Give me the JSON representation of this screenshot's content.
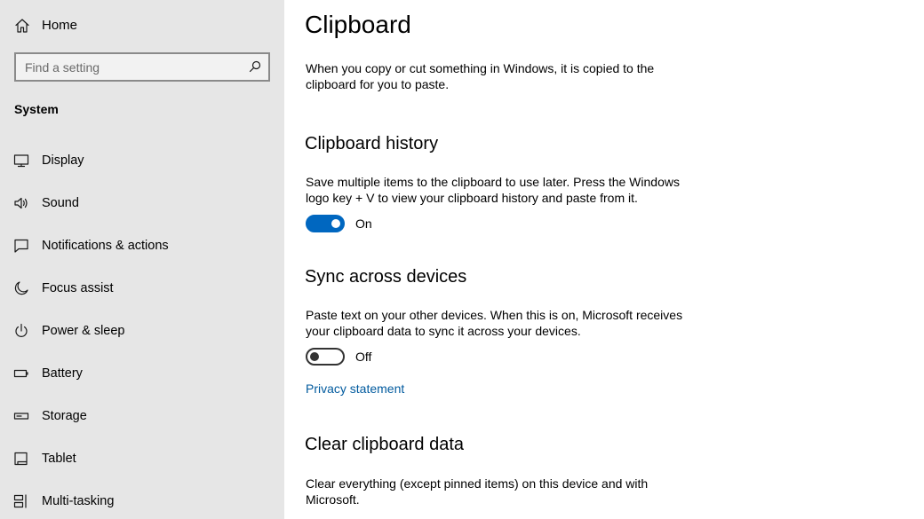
{
  "sidebar": {
    "home": {
      "label": "Home",
      "icon": "home-icon"
    },
    "search": {
      "placeholder": "Find a setting",
      "value": "",
      "icon": "search-icon"
    },
    "section_label": "System",
    "items": [
      {
        "label": "Display",
        "icon": "monitor-icon"
      },
      {
        "label": "Sound",
        "icon": "speaker-icon"
      },
      {
        "label": "Notifications & actions",
        "icon": "notification-icon"
      },
      {
        "label": "Focus assist",
        "icon": "moon-icon"
      },
      {
        "label": "Power & sleep",
        "icon": "power-icon"
      },
      {
        "label": "Battery",
        "icon": "battery-icon"
      },
      {
        "label": "Storage",
        "icon": "storage-icon"
      },
      {
        "label": "Tablet",
        "icon": "tablet-icon"
      },
      {
        "label": "Multi-tasking",
        "icon": "multitasking-icon"
      }
    ]
  },
  "main": {
    "title": "Clipboard",
    "intro": "When you copy or cut something in Windows, it is copied to the clipboard for you to paste.",
    "clipboard_history": {
      "heading": "Clipboard history",
      "description": "Save multiple items to the clipboard to use later. Press the Windows logo key + V to view your clipboard history and paste from it.",
      "toggle_state": "On"
    },
    "sync_across_devices": {
      "heading": "Sync across devices",
      "description": "Paste text on your other devices. When this is on, Microsoft receives your clipboard data to sync it across your devices.",
      "toggle_state": "Off",
      "link": "Privacy statement"
    },
    "clear_clipboard": {
      "heading": "Clear clipboard data",
      "description": "Clear everything (except pinned items) on this device and with Microsoft."
    }
  },
  "colors": {
    "sidebar_bg": "#e6e6e6",
    "accent": "#0067c0",
    "link": "#005a9e"
  }
}
